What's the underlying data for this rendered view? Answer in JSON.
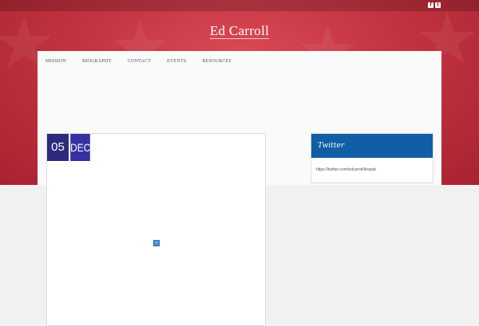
{
  "header": {
    "site_title": "Ed Carroll",
    "social": [
      {
        "icon": "facebook-icon",
        "glyph": "f"
      },
      {
        "icon": "twitter-icon",
        "glyph": "t"
      }
    ]
  },
  "nav": {
    "items": [
      {
        "label": "Mission"
      },
      {
        "label": "Biography"
      },
      {
        "label": "Contact"
      },
      {
        "label": "Events"
      },
      {
        "label": "Resources"
      }
    ]
  },
  "post": {
    "date_day": "05",
    "date_month": "DEC",
    "image_icon": "broken-image-icon"
  },
  "sidebar": {
    "widget_title": "Twitter",
    "widget_link": "https://twitter.com/edcarroll4repub"
  },
  "colors": {
    "hero_red": "#c43442",
    "date_day_bg": "#2d2b7d",
    "date_month_bg": "#3531a3",
    "widget_header_blue": "#0f5ea6"
  }
}
